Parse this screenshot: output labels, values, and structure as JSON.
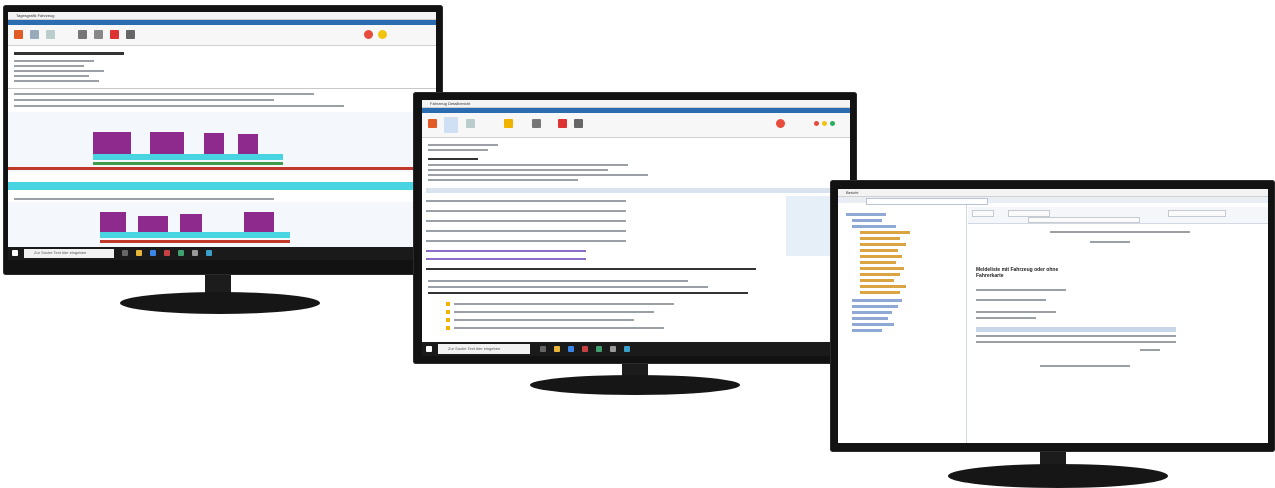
{
  "monitors": [
    {
      "name": "left-monitor",
      "app_title": "Tagesgrafik Fahrzeug",
      "taskbar_search": "Zur Suche Text hier eingeben"
    },
    {
      "name": "center-monitor",
      "app_title": "Fahrzeug Detailbericht",
      "taskbar_search": "Zur Suche Text hier eingeben"
    },
    {
      "name": "right-monitor",
      "app_title": "Bericht",
      "report_heading": "Meldeliste mit Fahrzeug oder ohne Fahrerkarte"
    }
  ],
  "colors": {
    "bezel": "#121212",
    "stand": "#161616",
    "accent_blue": "#2b6cb0",
    "chart_peak": "#8e2a8e",
    "chart_cyan": "#48d4e0",
    "chart_green": "#3c9c4a",
    "chart_red": "#c0392b"
  }
}
